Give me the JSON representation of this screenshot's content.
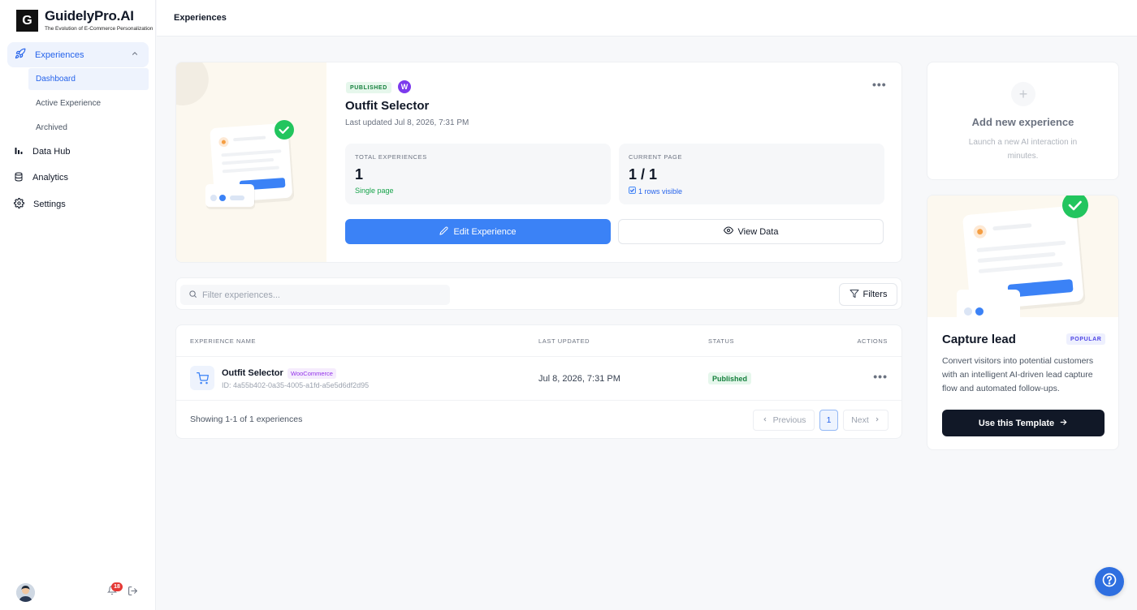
{
  "brand": {
    "mark": "G",
    "title": "GuidelyPro.AI",
    "tagline": "The Evolution of E-Commerce Personalization"
  },
  "sidebar": {
    "group": {
      "label": "Experiences",
      "icon": "rocket-icon"
    },
    "sub_items": [
      {
        "label": "Dashboard",
        "active": true
      },
      {
        "label": "Active Experience",
        "active": false
      },
      {
        "label": "Archived",
        "active": false
      }
    ],
    "items": [
      {
        "label": "Data Hub",
        "icon": "bar-chart-icon"
      },
      {
        "label": "Analytics",
        "icon": "database-icon"
      },
      {
        "label": "Settings",
        "icon": "gear-icon"
      }
    ],
    "notifications_count": "18"
  },
  "topbar": {
    "title": "Experiences"
  },
  "hero": {
    "status": "PUBLISHED",
    "platform_glyph": "W",
    "title": "Outfit Selector",
    "updated": "Last updated Jul 8, 2026, 7:31 PM",
    "stats": [
      {
        "label": "TOTAL EXPERIENCES",
        "value": "1",
        "note": "Single page"
      },
      {
        "label": "CURRENT PAGE",
        "value": "1 / 1",
        "note": "1 rows visible"
      }
    ],
    "edit_label": "Edit Experience",
    "view_label": "View Data"
  },
  "filter": {
    "placeholder": "Filter experiences...",
    "filters_label": "Filters"
  },
  "table": {
    "columns": [
      "EXPERIENCE NAME",
      "LAST UPDATED",
      "STATUS",
      "ACTIONS"
    ],
    "rows": [
      {
        "name": "Outfit Selector",
        "platform": "WooCommerce",
        "id": "ID: 4a55b402-0a35-4005-a1fd-a5e5d6df2d95",
        "updated": "Jul 8, 2026, 7:31 PM",
        "status": "Published"
      }
    ],
    "showing": "Showing 1-1 of 1 experiences",
    "pagination": {
      "previous": "Previous",
      "current": "1",
      "next": "Next"
    }
  },
  "add_card": {
    "title": "Add new experience",
    "subtitle": "Launch a new AI interaction in minutes."
  },
  "template_card": {
    "title": "Capture lead",
    "badge": "POPULAR",
    "description": "Convert visitors into potential customers with an intelligent AI-driven lead capture flow and automated follow-ups.",
    "button": "Use this Template"
  },
  "colors": {
    "accent": "#3b82f6",
    "success": "#22c55e",
    "dark": "#111827",
    "woo": "#9333ea"
  }
}
